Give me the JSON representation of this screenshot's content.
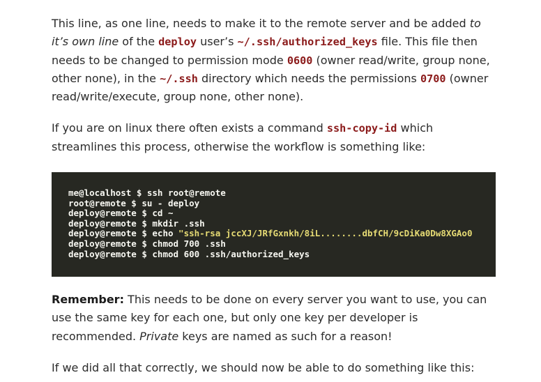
{
  "para1": {
    "t1": "This line, as one line, needs to make it to the remote server and be added ",
    "em1": "to it’s own line",
    "t2": " of the ",
    "c1": "deploy",
    "t3": " user’s ",
    "c2": "~/.ssh/authorized_keys",
    "t4": " file. This file then needs to be changed to permission mode ",
    "c3": "0600",
    "t5": " (owner read/write, group none, other none), in the ",
    "c4": "~/.ssh",
    "t6": " directory which needs the permissions ",
    "c5": "0700",
    "t7": " (owner read/write/execute, group none, other none)."
  },
  "para2": {
    "t1": "If you are on linux there often exists a command ",
    "c1": "ssh-copy-id",
    "t2": " which streamlines this process, otherwise the workflow is something like:"
  },
  "codeblock": {
    "lines": [
      "me@localhost $ ssh root@remote",
      "root@remote $ su - deploy",
      "deploy@remote $ cd ~",
      "deploy@remote $ mkdir .ssh",
      "deploy@remote $ echo ",
      "deploy@remote $ chmod 700 .ssh",
      "deploy@remote $ chmod 600 .ssh/authorized_keys"
    ],
    "echo_string": "\"ssh-rsa jccXJ/JRfGxnkh/8iL........dbfCH/9cDiKa0Dw8XGAo0"
  },
  "para3": {
    "strong": "Remember:",
    "t1": " This needs to be done on every server you want to use, you can use the same key for each one, but only one key per developer is recommended. ",
    "em1": "Private",
    "t2": " keys are named as such for a reason!"
  },
  "para4": {
    "t1": "If we did all that correctly, we should now be able to do something like this:"
  }
}
